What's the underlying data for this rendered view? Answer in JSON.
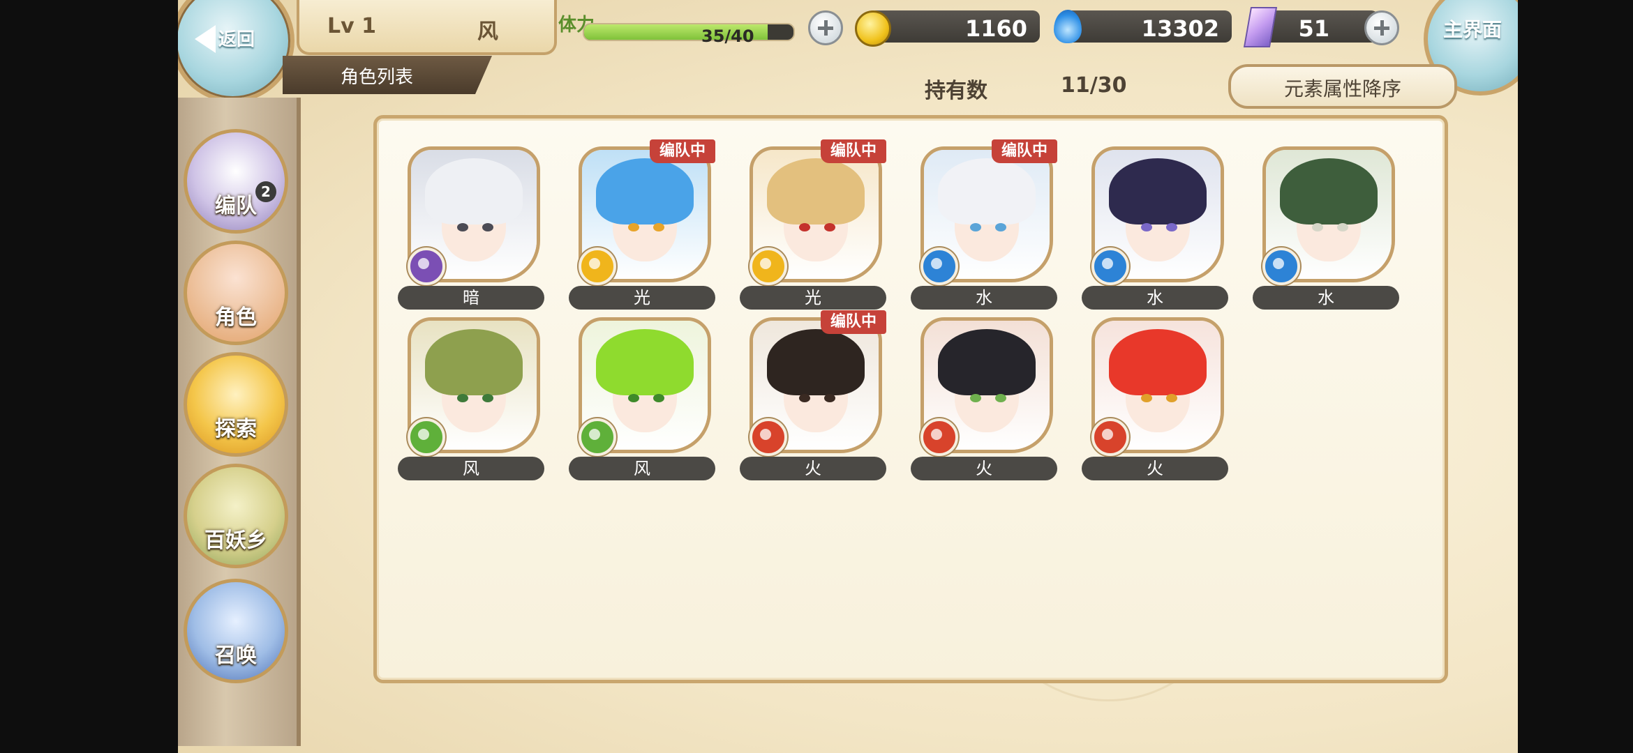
{
  "header": {
    "back_label": "返回",
    "level": "Lv 1",
    "element": "风",
    "tab_label": "角色列表",
    "home_label": "主界面"
  },
  "stamina": {
    "label": "体力",
    "value": "35/40",
    "fill_fraction": 0.875
  },
  "currencies": {
    "gold": "1160",
    "spirit": "13302",
    "crystal": "51"
  },
  "owned": {
    "label": "持有数",
    "value": "11/30"
  },
  "sort_label": "元素属性降序",
  "nav": [
    {
      "label": "编队",
      "badge": "2"
    },
    {
      "label": "角色"
    },
    {
      "label": "探索"
    },
    {
      "label": "百妖乡"
    },
    {
      "label": "召唤"
    }
  ],
  "team_tag_text": "编队中",
  "characters": [
    {
      "element": "暗",
      "in_team": false,
      "hair": "#eef0f4",
      "bg": "#d9dde6",
      "eye": "#4b4b55",
      "badge_color": "#7b4fb4"
    },
    {
      "element": "光",
      "in_team": true,
      "hair": "#4aa3e8",
      "bg": "#bfe0f6",
      "eye": "#e8a42a",
      "badge_color": "#f0b51c"
    },
    {
      "element": "光",
      "in_team": true,
      "hair": "#e3c07e",
      "bg": "#f6e7c9",
      "eye": "#c4322c",
      "badge_color": "#f0b51c"
    },
    {
      "element": "水",
      "in_team": true,
      "hair": "#f1f2f6",
      "bg": "#dfeaf5",
      "eye": "#5aa4d8",
      "badge_color": "#2d83d6"
    },
    {
      "element": "水",
      "in_team": false,
      "hair": "#2e2a4e",
      "bg": "#dfe3ee",
      "eye": "#7a68c8",
      "badge_color": "#2d83d6"
    },
    {
      "element": "水",
      "in_team": false,
      "hair": "#3e5e3c",
      "bg": "#dfe7d6",
      "eye": "#d6d6c8",
      "badge_color": "#2d83d6"
    },
    {
      "element": "风",
      "in_team": false,
      "hair": "#8ea04e",
      "bg": "#e8e2c2",
      "eye": "#3e7a3a",
      "badge_color": "#5fb03a"
    },
    {
      "element": "风",
      "in_team": false,
      "hair": "#8fdb2e",
      "bg": "#eef4dc",
      "eye": "#3e8a2a",
      "badge_color": "#5fb03a"
    },
    {
      "element": "火",
      "in_team": true,
      "hair": "#2e2520",
      "bg": "#efe7dc",
      "eye": "#3a2a22",
      "badge_color": "#d8432b"
    },
    {
      "element": "火",
      "in_team": false,
      "hair": "#26252b",
      "bg": "#f3e0d6",
      "eye": "#6fb04e",
      "badge_color": "#d8432b"
    },
    {
      "element": "火",
      "in_team": false,
      "hair": "#e8382a",
      "bg": "#f6e3dc",
      "eye": "#e0a02a",
      "badge_color": "#d8432b"
    }
  ]
}
